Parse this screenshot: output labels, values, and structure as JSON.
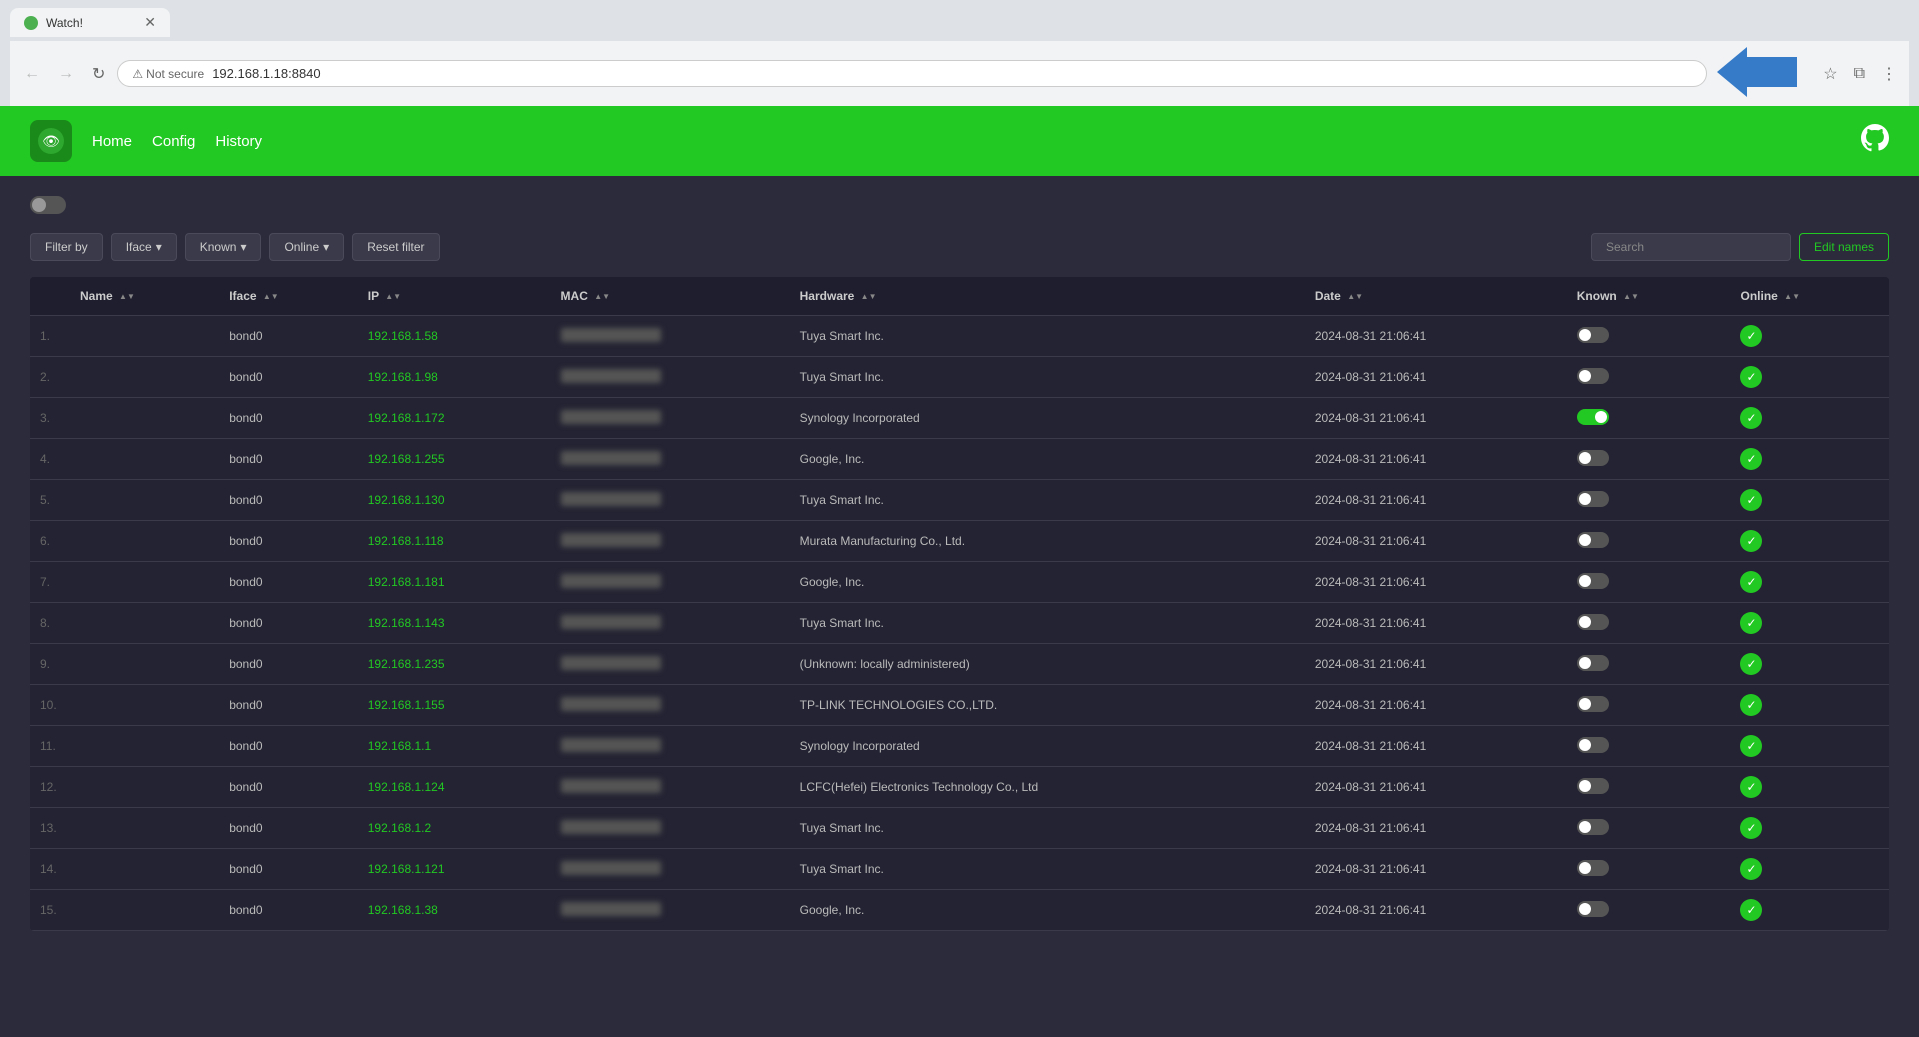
{
  "browser": {
    "tab_title": "Watch!",
    "address": "192.168.1.18:8840",
    "security_label": "Not secure"
  },
  "nav": {
    "home": "Home",
    "config": "Config",
    "history": "History"
  },
  "toolbar": {
    "filter_by": "Filter by",
    "iface": "Iface",
    "known": "Known",
    "online": "Online",
    "reset_filter": "Reset filter",
    "search_placeholder": "Search",
    "edit_names": "Edit names"
  },
  "table": {
    "columns": [
      {
        "id": "num",
        "label": ""
      },
      {
        "id": "name",
        "label": "Name"
      },
      {
        "id": "iface",
        "label": "Iface"
      },
      {
        "id": "ip",
        "label": "IP"
      },
      {
        "id": "mac",
        "label": "MAC"
      },
      {
        "id": "hardware",
        "label": "Hardware"
      },
      {
        "id": "date",
        "label": "Date"
      },
      {
        "id": "known",
        "label": "Known"
      },
      {
        "id": "online",
        "label": "Online"
      }
    ],
    "rows": [
      {
        "num": "1.",
        "name": "",
        "iface": "bond0",
        "ip": "192.168.1.58",
        "hardware": "Tuya Smart Inc.",
        "date": "2024-08-31 21:06:41",
        "known": false,
        "online": true
      },
      {
        "num": "2.",
        "name": "",
        "iface": "bond0",
        "ip": "192.168.1.98",
        "hardware": "Tuya Smart Inc.",
        "date": "2024-08-31 21:06:41",
        "known": false,
        "online": true
      },
      {
        "num": "3.",
        "name": "",
        "iface": "bond0",
        "ip": "192.168.1.172",
        "hardware": "Synology Incorporated",
        "date": "2024-08-31 21:06:41",
        "known": true,
        "online": true
      },
      {
        "num": "4.",
        "name": "",
        "iface": "bond0",
        "ip": "192.168.1.255",
        "hardware": "Google, Inc.",
        "date": "2024-08-31 21:06:41",
        "known": false,
        "online": true
      },
      {
        "num": "5.",
        "name": "",
        "iface": "bond0",
        "ip": "192.168.1.130",
        "hardware": "Tuya Smart Inc.",
        "date": "2024-08-31 21:06:41",
        "known": false,
        "online": true
      },
      {
        "num": "6.",
        "name": "",
        "iface": "bond0",
        "ip": "192.168.1.118",
        "hardware": "Murata Manufacturing Co., Ltd.",
        "date": "2024-08-31 21:06:41",
        "known": false,
        "online": true
      },
      {
        "num": "7.",
        "name": "",
        "iface": "bond0",
        "ip": "192.168.1.181",
        "hardware": "Google, Inc.",
        "date": "2024-08-31 21:06:41",
        "known": false,
        "online": true
      },
      {
        "num": "8.",
        "name": "",
        "iface": "bond0",
        "ip": "192.168.1.143",
        "hardware": "Tuya Smart Inc.",
        "date": "2024-08-31 21:06:41",
        "known": false,
        "online": true
      },
      {
        "num": "9.",
        "name": "",
        "iface": "bond0",
        "ip": "192.168.1.235",
        "hardware": "(Unknown: locally administered)",
        "date": "2024-08-31 21:06:41",
        "known": false,
        "online": true
      },
      {
        "num": "10.",
        "name": "",
        "iface": "bond0",
        "ip": "192.168.1.155",
        "hardware": "TP-LINK TECHNOLOGIES CO.,LTD.",
        "date": "2024-08-31 21:06:41",
        "known": false,
        "online": true
      },
      {
        "num": "11.",
        "name": "",
        "iface": "bond0",
        "ip": "192.168.1.1",
        "hardware": "Synology Incorporated",
        "date": "2024-08-31 21:06:41",
        "known": false,
        "online": true
      },
      {
        "num": "12.",
        "name": "",
        "iface": "bond0",
        "ip": "192.168.1.124",
        "hardware": "LCFC(Hefei) Electronics Technology Co., Ltd",
        "date": "2024-08-31 21:06:41",
        "known": false,
        "online": true
      },
      {
        "num": "13.",
        "name": "",
        "iface": "bond0",
        "ip": "192.168.1.2",
        "hardware": "Tuya Smart Inc.",
        "date": "2024-08-31 21:06:41",
        "known": false,
        "online": true
      },
      {
        "num": "14.",
        "name": "",
        "iface": "bond0",
        "ip": "192.168.1.121",
        "hardware": "Tuya Smart Inc.",
        "date": "2024-08-31 21:06:41",
        "known": false,
        "online": true
      },
      {
        "num": "15.",
        "name": "",
        "iface": "bond0",
        "ip": "192.168.1.38",
        "hardware": "Google, Inc.",
        "date": "2024-08-31 21:06:41",
        "known": false,
        "online": true
      }
    ]
  }
}
